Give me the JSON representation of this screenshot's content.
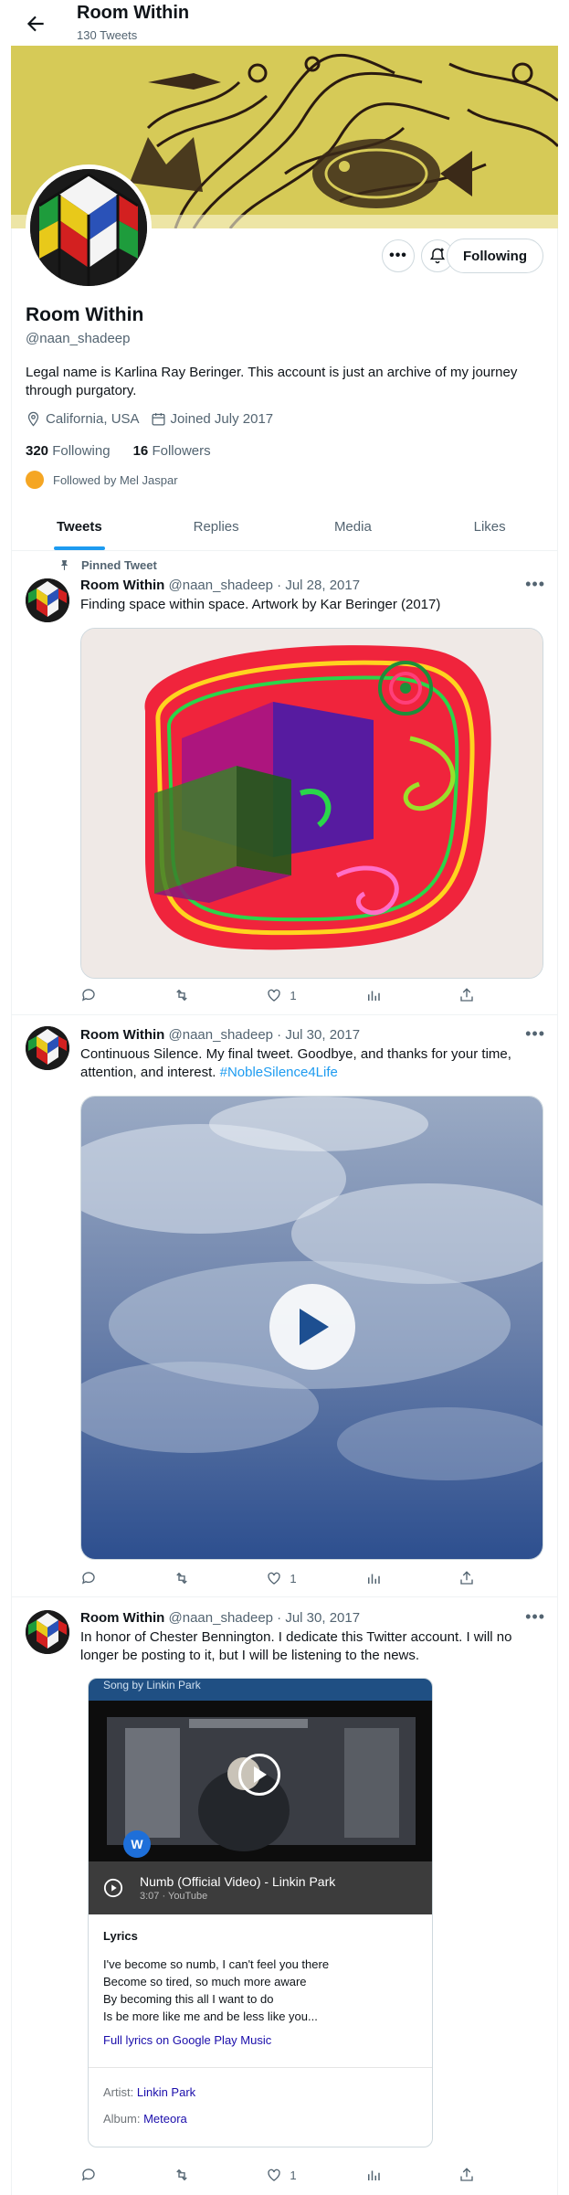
{
  "header": {
    "title": "Room Within",
    "subtitle": "130 Tweets"
  },
  "profile": {
    "name": "Room Within",
    "handle": "@naan_shadeep",
    "bio": "Legal name is Karlina Ray Beringer. This account is just an archive of my journey through purgatory.",
    "location": "California, USA",
    "joined": "Joined July 2017",
    "following_count": "320",
    "following_label": "Following",
    "followers_count": "16",
    "followers_label": "Followers",
    "followed_by": "Followed by Mel Jaspar",
    "follow_button": "Following"
  },
  "tabs": [
    "Tweets",
    "Replies",
    "Media",
    "Likes"
  ],
  "tweets": [
    {
      "pinned_label": "Pinned Tweet",
      "name": "Room Within",
      "handle_date": "@naan_shadeep · Jul 28, 2017",
      "text": "Finding space within space. Artwork by Kar Beringer (2017)",
      "likes": "1"
    },
    {
      "name": "Room Within",
      "handle_date": "@naan_shadeep · Jul 30, 2017",
      "text": "Continuous Silence. My final tweet. Goodbye, and thanks for your time, attention, and interest. ",
      "hashtag": "#NobleSilence4Life",
      "likes": "1"
    },
    {
      "name": "Room Within",
      "handle_date": "@naan_shadeep · Jul 30, 2017",
      "text": "In honor of Chester Bennington. I dedicate this Twitter account. I will no longer be posting to it, but I will be listening to the news.",
      "likes": "1",
      "card": {
        "top": "Song by Linkin Park",
        "video_title": "Numb (Official Video) - Linkin Park",
        "video_sub": "3:07 · YouTube",
        "lyrics_heading": "Lyrics",
        "lyrics": [
          "I've become so numb, I can't feel you there",
          "Become so tired, so much more aware",
          "By becoming this all I want to do",
          "Is be more like me and be less like you..."
        ],
        "lyrics_link": "Full lyrics on Google Play Music",
        "artist_label": "Artist: ",
        "artist": "Linkin Park",
        "album_label": "Album: ",
        "album": "Meteora"
      }
    }
  ]
}
